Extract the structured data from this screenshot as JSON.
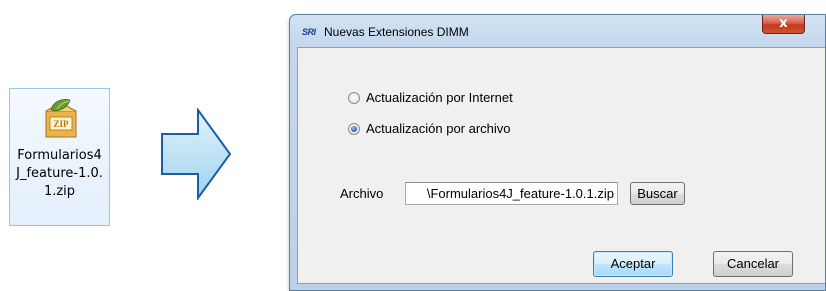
{
  "file_icon": {
    "icon": "zip-archive-icon",
    "badge_text": "ZIP",
    "filename": "Formularios4J_feature-1.0.1.zip"
  },
  "arrow": {
    "icon": "right-arrow-icon",
    "color": "#9ed3ef"
  },
  "window": {
    "app_icon": "SRI",
    "title": "Nuevas Extensiones DIMM",
    "close_label": "x",
    "options": [
      {
        "label": "Actualización por Internet",
        "selected": false
      },
      {
        "label": "Actualización por archivo",
        "selected": true
      }
    ],
    "file_field": {
      "label": "Archivo",
      "value": "\\Formularios4J_feature-1.0.1.zip",
      "browse_label": "Buscar"
    },
    "buttons": {
      "accept_label": "Aceptar",
      "cancel_label": "Cancelar"
    }
  },
  "colors": {
    "accent": "#3c7fb1",
    "close_button": "#c4391f",
    "window_frame": "#c4d7ec"
  }
}
